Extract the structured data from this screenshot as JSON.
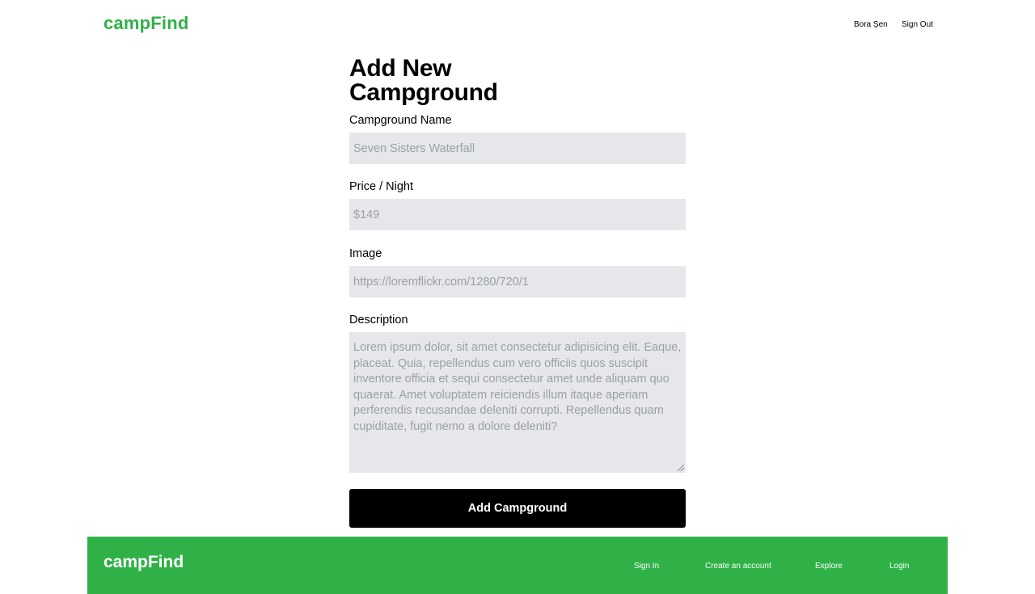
{
  "header": {
    "logo": "campFind",
    "user_name": "Bora Şen",
    "sign_out_label": "Sign Out"
  },
  "form": {
    "title": "Add New Campground",
    "name_label": "Campground Name",
    "name_placeholder": "Seven Sisters Waterfall",
    "price_label": "Price / Night",
    "price_placeholder": "$149",
    "image_label": "Image",
    "image_placeholder": "https://loremflickr.com/1280/720/1",
    "description_label": "Description",
    "description_placeholder": "Lorem ipsum dolor, sit amet consectetur adipisicing elit. Eaque, placeat. Quia, repellendus cum vero officiis quos suscipit inventore officia et sequi consectetur amet unde aliquam quo quaerat. Amet voluptatem reiciendis illum itaque aperiam perferendis recusandae deleniti corrupti. Repellendus quam cupiditate, fugit nemo a dolore deleniti?",
    "submit_label": "Add Campground"
  },
  "footer": {
    "logo": "campFind",
    "links": [
      "Sign In",
      "Create an account",
      "Explore",
      "Login"
    ]
  },
  "colors": {
    "brand": "#2fb147",
    "input_bg": "#e5e7ea",
    "button_bg": "#000000"
  }
}
